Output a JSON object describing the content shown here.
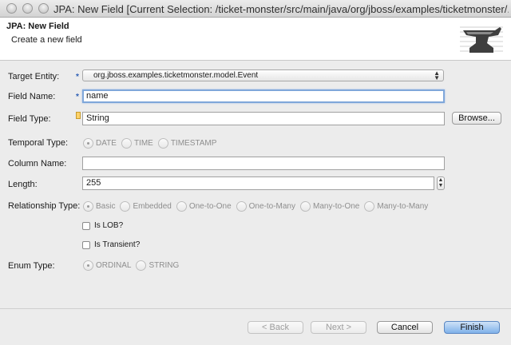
{
  "window": {
    "title": "JPA: New Field [Current Selection: /ticket-monster/src/main/java/org/jboss/examples/ticketmonster/..."
  },
  "header": {
    "title": "JPA: New Field",
    "subtitle": "Create a new field",
    "logo_icon": "anvil-icon"
  },
  "form": {
    "target_entity": {
      "label": "Target Entity:",
      "value": "org.jboss.examples.ticketmonster.model.Event"
    },
    "field_name": {
      "label": "Field Name:",
      "value": "name"
    },
    "field_type": {
      "label": "Field Type:",
      "value": "String",
      "browse_label": "Browse..."
    },
    "temporal_type": {
      "label": "Temporal Type:",
      "options": [
        "DATE",
        "TIME",
        "TIMESTAMP"
      ],
      "selected": "DATE"
    },
    "column_name": {
      "label": "Column Name:",
      "value": ""
    },
    "length": {
      "label": "Length:",
      "value": "255"
    },
    "relationship_type": {
      "label": "Relationship Type:",
      "options": [
        "Basic",
        "Embedded",
        "One-to-One",
        "One-to-Many",
        "Many-to-One",
        "Many-to-Many"
      ],
      "selected": "Basic"
    },
    "is_lob": {
      "label": "Is LOB?",
      "checked": false
    },
    "is_transient": {
      "label": "Is Transient?",
      "checked": false
    },
    "enum_type": {
      "label": "Enum Type:",
      "options": [
        "ORDINAL",
        "STRING"
      ],
      "selected": "ORDINAL"
    },
    "required_marker": "*"
  },
  "buttons": {
    "back": "< Back",
    "next": "Next >",
    "cancel": "Cancel",
    "finish": "Finish"
  },
  "colors": {
    "accent": "#7fa7da",
    "default_button": "#7fb1ea",
    "required_marker": "#2d5fb5"
  }
}
